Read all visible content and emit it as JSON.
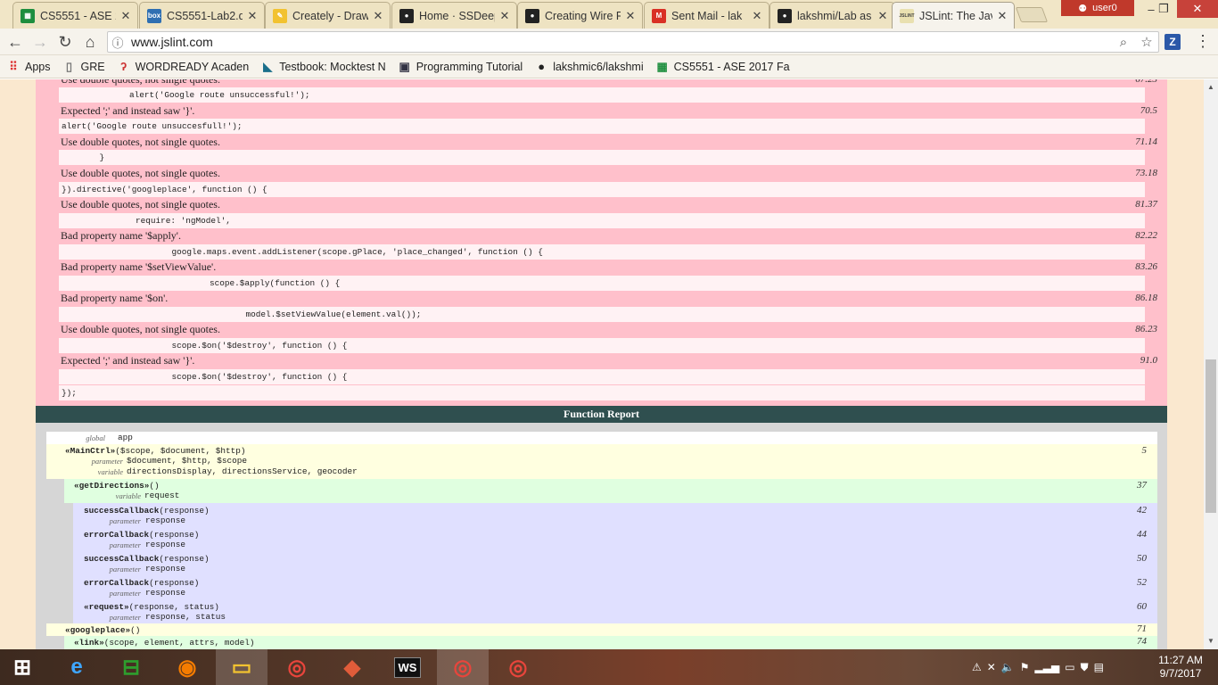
{
  "browser": {
    "tabs": [
      {
        "title": "CS5551 - ASE 2",
        "icon": "sheets-icon",
        "color": "#1e8e3e",
        "glyph": "▦"
      },
      {
        "title": "CS5551-Lab2.d",
        "icon": "box-icon",
        "color": "#2f6fb2",
        "glyph": "box"
      },
      {
        "title": "Creately - Draw",
        "icon": "creately-icon",
        "color": "#f2c230",
        "glyph": "✎"
      },
      {
        "title": "Home · SSDeep",
        "icon": "github-icon",
        "color": "#222222",
        "glyph": "●"
      },
      {
        "title": "Creating Wire F",
        "icon": "github-icon",
        "color": "#222222",
        "glyph": "●"
      },
      {
        "title": "Sent Mail - lak",
        "icon": "gmail-icon",
        "color": "#d93025",
        "glyph": "M"
      },
      {
        "title": "lakshmi/Lab as",
        "icon": "github-icon",
        "color": "#222222",
        "glyph": "●"
      },
      {
        "title": "JSLint: The Java",
        "icon": "jslint-icon",
        "color": "#e9e0b0",
        "glyph": "JSLINT"
      }
    ],
    "user": "user0",
    "url": "www.jslint.com",
    "extension_label": "Z",
    "bookmarks": [
      {
        "label": "Apps",
        "icon": "apps-grid-icon"
      },
      {
        "label": "GRE",
        "icon": "page-icon"
      },
      {
        "label": "WORDREADY Acaden",
        "icon": "wordready-icon"
      },
      {
        "label": "Testbook: Mocktest N",
        "icon": "testbook-icon"
      },
      {
        "label": "Programming Tutorial",
        "icon": "tutorial-icon"
      },
      {
        "label": "lakshmic6/lakshmi",
        "icon": "github-icon"
      },
      {
        "label": "CS5551 - ASE 2017 Fa",
        "icon": "sheets-icon"
      }
    ]
  },
  "warnings": [
    {
      "code": "alert('Google route unsuccessful!');",
      "message": "Use double quotes, not single quotes.",
      "line": "67.23"
    },
    {
      "code": "alert('Google route unsuccesfull!');",
      "message": "Expected ';' and instead saw '}'.",
      "line": "70.5"
    },
    {
      "code": "    }",
      "message": "Use double quotes, not single quotes.",
      "line": "71.14"
    },
    {
      "code": "}).directive('googleplace', function () {",
      "message": "Use double quotes, not single quotes.",
      "line": "73.18"
    },
    {
      "code": "        require: 'ngModel',",
      "message": "Use double quotes, not single quotes.",
      "line": "81.37"
    },
    {
      "code": "            google.maps.event.addListener(scope.gPlace, 'place_changed', function () {",
      "message": "Bad property name '$apply'.",
      "line": "82.22"
    },
    {
      "code": "                scope.$apply(function () {",
      "message": "Bad property name '$setViewValue'.",
      "line": "83.26"
    },
    {
      "code": "                    model.$setViewValue(element.val());",
      "message": "Bad property name '$on'.",
      "line": "86.18"
    },
    {
      "code": "            scope.$on('$destroy', function () {",
      "message": "Use double quotes, not single quotes.",
      "line": "86.23"
    },
    {
      "code": "            scope.$on('$destroy', function () {",
      "message": "Expected ';' and instead saw '}'.",
      "line": "91.0"
    },
    {
      "code": "});",
      "message": "",
      "line": ""
    }
  ],
  "function_report": {
    "title": "Function Report",
    "global": {
      "label": "global",
      "value": "app"
    },
    "functions": [
      {
        "name": "«MainCtrl»",
        "params": "($scope, $document, $http)",
        "line": "5",
        "details": [
          {
            "label": "parameter",
            "value": "$document, $http, $scope"
          },
          {
            "label": "variable",
            "value": "directionsDisplay, directionsService, geocoder"
          }
        ]
      },
      {
        "name": "«getDirections»",
        "params": "()",
        "line": "37",
        "details": [
          {
            "label": "variable",
            "value": "request"
          }
        ]
      },
      {
        "name": "successCallback",
        "params": "(response)",
        "line": "42",
        "details": [
          {
            "label": "parameter",
            "value": "response"
          }
        ]
      },
      {
        "name": "errorCallback",
        "params": "(response)",
        "line": "44",
        "details": [
          {
            "label": "parameter",
            "value": "response"
          }
        ]
      },
      {
        "name": "successCallback",
        "params": "(response)",
        "line": "50",
        "details": [
          {
            "label": "parameter",
            "value": "response"
          }
        ]
      },
      {
        "name": "errorCallback",
        "params": "(response)",
        "line": "52",
        "details": [
          {
            "label": "parameter",
            "value": "response"
          }
        ]
      },
      {
        "name": "«request»",
        "params": "(response, status)",
        "line": "60",
        "details": [
          {
            "label": "parameter",
            "value": "response, status"
          }
        ]
      },
      {
        "name": "«googleplace»",
        "params": "()",
        "line": "71",
        "details": []
      },
      {
        "name": "«link»",
        "params": "(scope, element, attrs, model)",
        "line": "74",
        "details": []
      }
    ]
  },
  "taskbar": {
    "apps": [
      "start-icon",
      "ie-icon",
      "store-icon",
      "firefox-icon",
      "file-explorer-icon",
      "chrome-icon",
      "git-icon",
      "webstorm-icon",
      "chrome-icon",
      "chrome-icon"
    ],
    "time": "11:27 AM",
    "date": "9/7/2017"
  },
  "colors": {
    "warning_bg": "#ffc0cb",
    "report_header": "#2f4f4f",
    "level1": "#ffffe0",
    "level2": "#e0ffe0",
    "level3": "#e0e0ff"
  }
}
